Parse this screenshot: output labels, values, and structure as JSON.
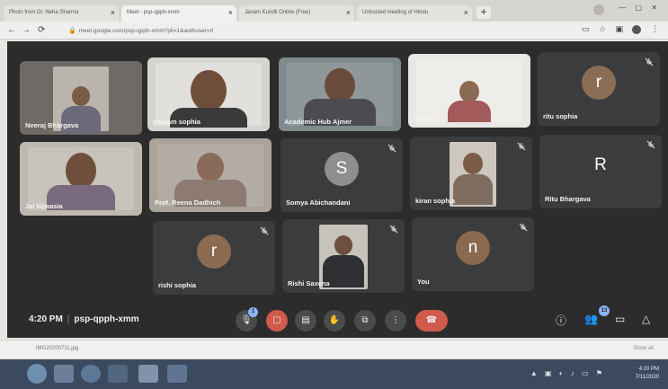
{
  "browser": {
    "tabs": [
      {
        "label": "Photo from Dr. Neha Sharma"
      },
      {
        "label": "Meet - psp-qpph-xmm"
      },
      {
        "label": "Janam Kundli Online (Free)"
      },
      {
        "label": "Untrusted meeting of Hindu"
      }
    ],
    "url": "meet.google.com/psp-qpph-xmm?pli=1&authuser=0",
    "new_tab_label": "+"
  },
  "meeting": {
    "time": "4:20 PM",
    "code": "psp-qpph-xmm",
    "participants_badge": "13",
    "raise_badge": "1"
  },
  "participants": [
    {
      "name": "Neeraj Bhargava",
      "kind": "video",
      "muted": false
    },
    {
      "name": "gautam sophia",
      "kind": "video",
      "muted": false
    },
    {
      "name": "Academic Hub Ajmer",
      "kind": "video",
      "muted": false
    },
    {
      "name": "sarla",
      "kind": "video",
      "muted": false
    },
    {
      "name": "ritu sophia",
      "kind": "avatar",
      "initial": "r",
      "color": "#8a6d55",
      "muted": true
    },
    {
      "name": "Jai bijwasia",
      "kind": "video",
      "muted": false
    },
    {
      "name": "Prof. Reena Dadhich",
      "kind": "video",
      "muted": false
    },
    {
      "name": "Somya Abichandani",
      "kind": "avatar",
      "initial": "S",
      "color": "#8e8e8e",
      "muted": true
    },
    {
      "name": "kiran sophia",
      "kind": "video",
      "muted": true
    },
    {
      "name": "Ritu Bhargava",
      "kind": "avatar",
      "initial": "R",
      "color": "#3b3c3e",
      "muted": true
    },
    {
      "name": "rishi sophia",
      "kind": "avatar",
      "initial": "r",
      "color": "#8b6b52",
      "muted": true
    },
    {
      "name": "Rishi Saxena",
      "kind": "video",
      "muted": true
    },
    {
      "name": "You",
      "kind": "avatar",
      "initial": "n",
      "color": "#8a6a4f",
      "muted": true
    }
  ],
  "colors": {
    "accent_blue": "#8ab4f8",
    "end_call_red": "#d05b4c",
    "tile_bg": "#3b3c3e",
    "stage_bg": "#2c2c2c"
  },
  "downloads": {
    "item": "IMG20200711.jpg",
    "show_all": "Show all"
  },
  "taskbar": {
    "time": "4:20 PM",
    "date": "7/11/2020"
  }
}
